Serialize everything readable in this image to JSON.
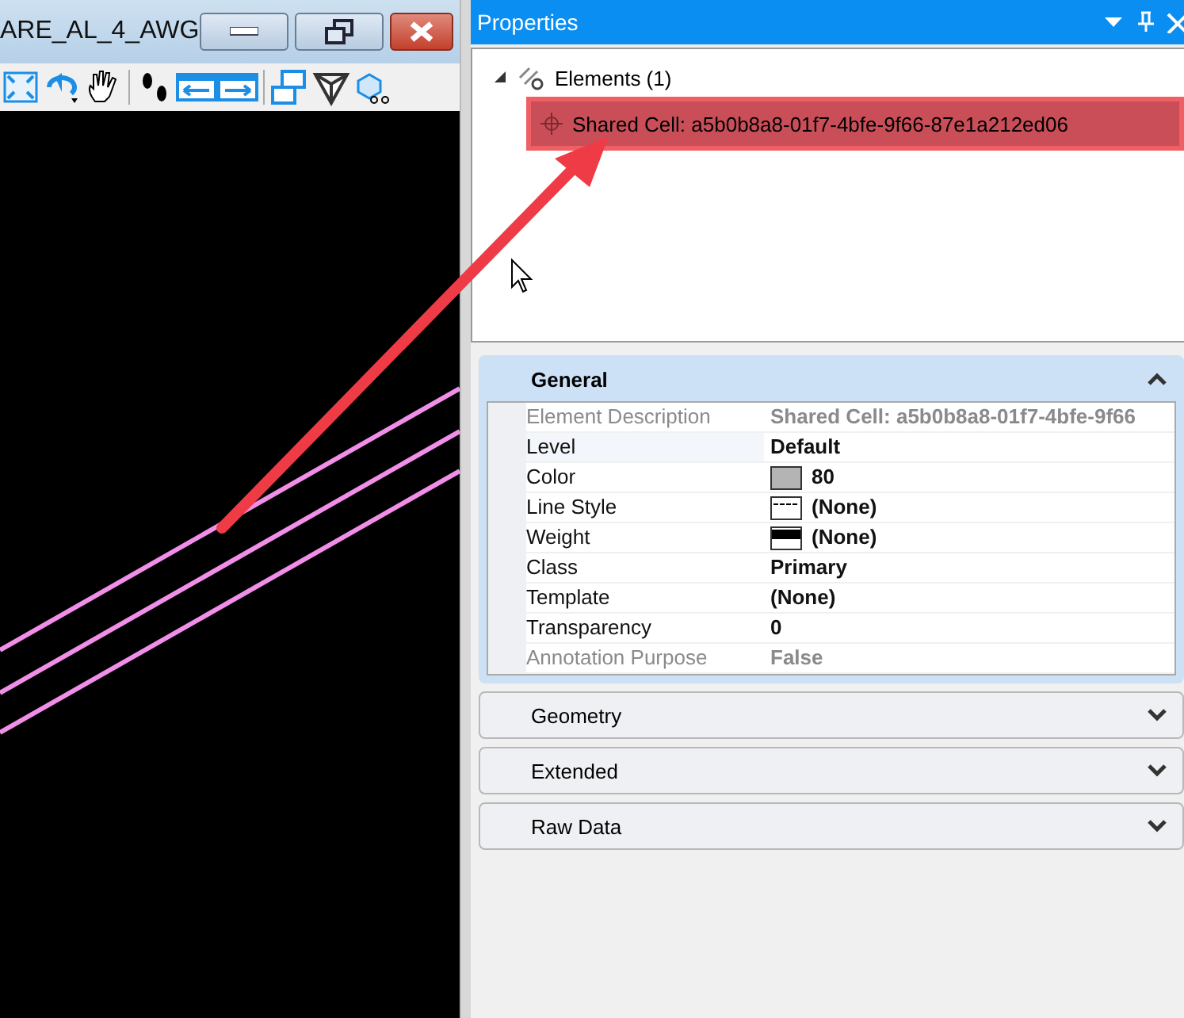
{
  "view_window": {
    "title": "ARE_AL_4_AWG"
  },
  "properties": {
    "title": "Properties",
    "tree": [
      {
        "label": "Elements (1)",
        "expanded": true,
        "children": [
          {
            "label": "Shared Cell: a5b0b8a8-01f7-4bfe-9f66-87e1a212ed06",
            "selected": true
          }
        ]
      }
    ],
    "sections": [
      {
        "title": "General",
        "expanded": true,
        "rows": [
          {
            "label": "Element Description",
            "value": "Shared Cell: a5b0b8a8-01f7-4bfe-9f66",
            "kind": "text",
            "disabled": true
          },
          {
            "label": "Level",
            "value": "Default",
            "kind": "text",
            "disabled": false
          },
          {
            "label": "Color",
            "value": "80",
            "kind": "color",
            "disabled": false
          },
          {
            "label": "Line Style",
            "value": "(None)",
            "kind": "linestyle",
            "disabled": false
          },
          {
            "label": "Weight",
            "value": "(None)",
            "kind": "weight",
            "disabled": false
          },
          {
            "label": "Class",
            "value": "Primary",
            "kind": "text",
            "disabled": false
          },
          {
            "label": "Template",
            "value": "(None)",
            "kind": "text",
            "disabled": false
          },
          {
            "label": "Transparency",
            "value": "0",
            "kind": "text",
            "disabled": false
          },
          {
            "label": "Annotation Purpose",
            "value": "False",
            "kind": "text",
            "disabled": true
          }
        ]
      },
      {
        "title": "Geometry",
        "expanded": false
      },
      {
        "title": "Extended",
        "expanded": false
      },
      {
        "title": "Raw Data",
        "expanded": false
      }
    ]
  }
}
